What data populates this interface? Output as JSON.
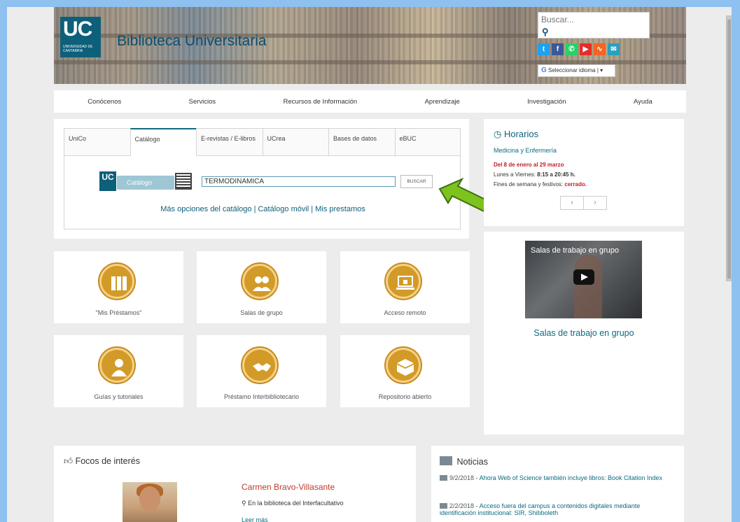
{
  "header": {
    "logo_text": "UC",
    "logo_sub": "UNIVERSIDAD DE CANTABRIA",
    "site_title": "Biblioteca Universitaria",
    "search_placeholder": "Buscar...",
    "social_icons": [
      "twitter-icon",
      "facebook-icon",
      "whatsapp-icon",
      "youtube-icon",
      "rss-icon",
      "mail-icon"
    ],
    "language_selector": "Seleccionar idioma"
  },
  "nav": {
    "items": [
      "Conócenos",
      "Servicios",
      "Recursos de Información",
      "Aprendizaje",
      "Investigación",
      "Ayuda"
    ]
  },
  "catalog": {
    "tabs": [
      "UniCo",
      "Catálogo",
      "E-revistas / E-libros",
      "UCrea",
      "Bases de datos",
      "eBUC"
    ],
    "active_tab": "Catálogo",
    "logo_label": "Catálogo",
    "search_value": "TERMODINAMICA",
    "search_button": "BUSCAR",
    "links": "Más opciones del catálogo | Catálogo móvil | Mis prestamos"
  },
  "horarios": {
    "title": "Horarios",
    "subtitle": "Medicina y Enfermería",
    "dates": "Del 8 de enero al 29 marzo",
    "weekdays_label": "Lunes a Viernes:",
    "weekdays_hours": "8:15 a 20:45 h.",
    "weekend_label": "Fines de semana y festivos:",
    "weekend_status": "cerrado.",
    "prev": "‹",
    "next": "›"
  },
  "tiles": [
    {
      "label": "\"Mis Préstamos\""
    },
    {
      "label": "Salas de grupo"
    },
    {
      "label": "Acceso remoto"
    },
    {
      "label": "Guías y tutoriales"
    },
    {
      "label": "Préstamo Interbibliotecario"
    },
    {
      "label": "Repositorio abierto"
    }
  ],
  "video": {
    "overlay_title": "Salas de trabajo en grupo",
    "caption": "Salas de trabajo en grupo"
  },
  "focos": {
    "title": "Focos de interés",
    "name": "Carmen Bravo-Villasante",
    "place": "En la biblioteca del Interfacultativo",
    "more": "Leer más"
  },
  "noticias": {
    "title": "Noticias",
    "items": [
      {
        "date": "9/2/2018",
        "text": "Ahora Web of Science también incluye libros: Book Citation Index"
      },
      {
        "date": "2/2/2018",
        "text": "Acceso fuera del campus a contenidos digitales mediante identificación institucional: SIR, Shibboleth"
      }
    ]
  },
  "colors": {
    "brand": "#0d5f7a",
    "accent_gold": "#d29a27",
    "arrow_green": "#7dc21e",
    "alert_red": "#c0202a"
  }
}
